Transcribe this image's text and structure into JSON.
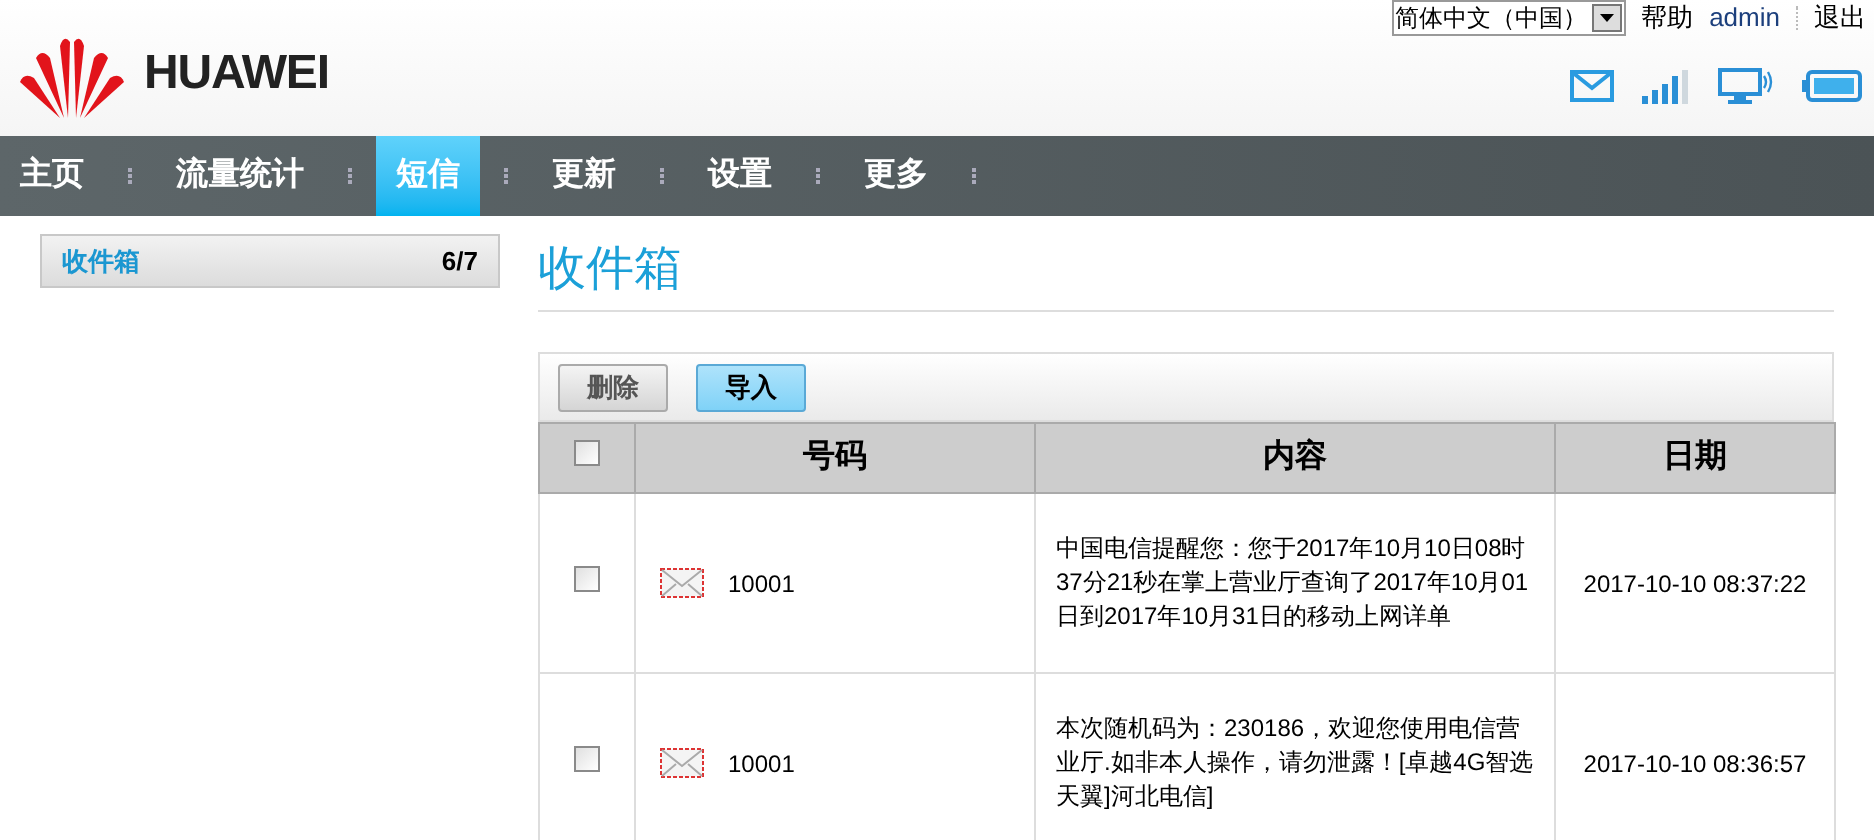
{
  "header": {
    "brand": "HUAWEI",
    "language": "简体中文（中国）",
    "links": [
      "帮助",
      "admin",
      "退出"
    ]
  },
  "nav": [
    {
      "label": "主页",
      "selected": false
    },
    {
      "label": "流量统计",
      "selected": false
    },
    {
      "label": "短信",
      "selected": true
    },
    {
      "label": "更新",
      "selected": false
    },
    {
      "label": "设置",
      "selected": false
    },
    {
      "label": "更多",
      "selected": false
    }
  ],
  "sidebar": {
    "items": [
      {
        "label": "收件箱",
        "count": "6/7",
        "selected": true
      }
    ]
  },
  "page_title": "收件箱",
  "toolbar": {
    "buttons": [
      {
        "label": "删除",
        "kind": "disabled"
      },
      {
        "label": "导入",
        "kind": "primary"
      }
    ]
  },
  "table": {
    "select_all": {
      "checked": false
    },
    "columns": [
      "号码",
      "内容",
      "日期"
    ],
    "rows": [
      {
        "checked": false,
        "number": "10001",
        "content": "中国电信提醒您：您于2017年10月10日08时37分21秒在掌上营业厅查询了2017年10月01日到2017年10月31日的移动上网详单",
        "date": "2017-10-10 08:37:22"
      },
      {
        "checked": false,
        "number": "10001",
        "content": "本次随机码为：230186，欢迎您使用电信营业厅.如非本人操作，请勿泄露！[卓越4G智选天翼]河北电信]",
        "date": "2017-10-10 08:36:57"
      }
    ]
  }
}
